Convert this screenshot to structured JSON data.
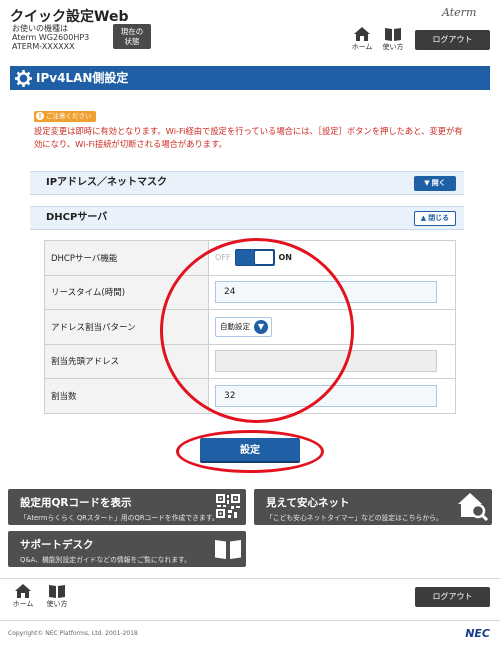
{
  "header": {
    "app_title": "クイック設定Web",
    "model_label": "お使いの機種は",
    "model_name": "Aterm WG2600HP3",
    "device_name": "ATERM-XXXXXX",
    "status_button": "現在の\n状態",
    "brand": "Aterm",
    "home_label": "ホーム",
    "help_label": "使い方",
    "logout_label": "ログアウト"
  },
  "page": {
    "title": "IPv4LAN側設定"
  },
  "notice": {
    "badge": "ご注意ください",
    "text": "設定変更は即時に有効となります。Wi-Fi経由で設定を行っている場合には、［設定］ボタンを押したあと、変更が有効になり、Wi-Fi接続が切断される場合があります。"
  },
  "sections": {
    "ip_mask": {
      "label": "IPアドレス／ネットマスク",
      "toggle": "開く"
    },
    "dhcp": {
      "label": "DHCPサーバ",
      "toggle": "閉じる"
    }
  },
  "dhcp_settings": {
    "function_label": "DHCPサーバ機能",
    "toggle_off": "OFF",
    "toggle_on": "ON",
    "lease_label": "リースタイム(時間)",
    "lease_value": "24",
    "pattern_label": "アドレス割当パターン",
    "pattern_value": "自動設定",
    "start_label": "割当先頭アドレス",
    "start_value": "",
    "count_label": "割当数",
    "count_value": "32"
  },
  "apply_button": "設定",
  "cards": {
    "qr": {
      "title": "設定用QRコードを表示",
      "desc": "「Atermらくらく QRスタート」用のQRコードを作成できます。"
    },
    "safe": {
      "title": "見えて安心ネット",
      "desc": "「こども安心ネットタイマー」などの設定はこちらから。"
    },
    "support": {
      "title": "サポートデスク",
      "desc": "Q&A、機能別設定ガイドなどの情報をご覧になれます。"
    }
  },
  "footer": {
    "home_label": "ホーム",
    "help_label": "使い方",
    "logout_label": "ログアウト",
    "copyright": "Copyright© NEC Platforms, Ltd. 2001-2018",
    "maker": "NEC"
  },
  "colors": {
    "primary_blue": "#1e5fa5",
    "annotation_red": "#e3121f",
    "notice_red": "#cc2b22",
    "card_gray": "#4f4f4f"
  }
}
